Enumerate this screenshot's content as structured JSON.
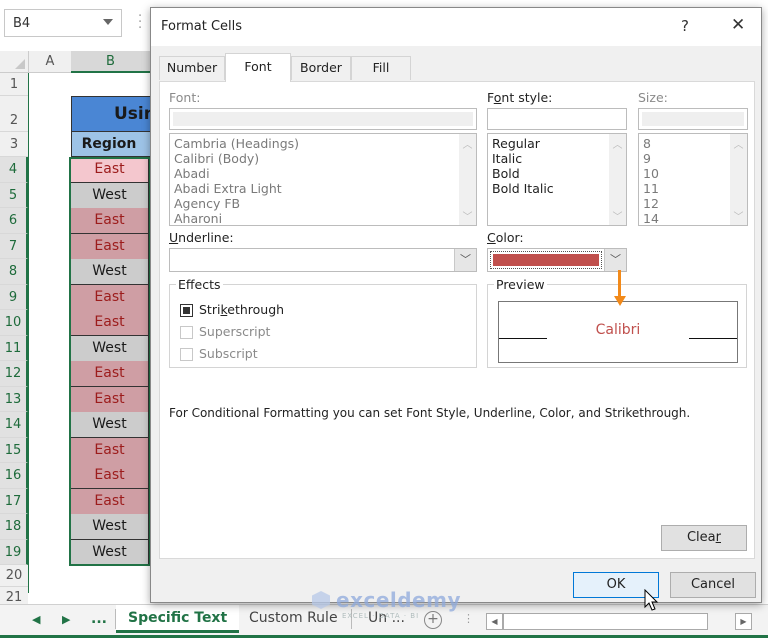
{
  "excel": {
    "name_box": "B4",
    "columns": [
      "A",
      "B"
    ],
    "rows": [
      "1",
      "2",
      "3",
      "4",
      "5",
      "6",
      "7",
      "8",
      "9",
      "10",
      "11",
      "12",
      "13",
      "14",
      "15",
      "16",
      "17",
      "18",
      "19",
      "20",
      "21"
    ],
    "title_cell": "Usin",
    "header_cell": "Region",
    "region_values": [
      "East",
      "West",
      "East",
      "East",
      "West",
      "East",
      "East",
      "West",
      "East",
      "East",
      "West",
      "East",
      "East",
      "East",
      "West",
      "West"
    ],
    "colors": {
      "accent": "#217346",
      "title_fill": "#4a86d4",
      "header_fill": "#9dc3e6",
      "east_fill": "#cf9ea4",
      "east_text": "#9c1c1c",
      "west_fill": "#cccccc"
    }
  },
  "sheet_tabs": {
    "nav_prev": "◀",
    "nav_next": "▶",
    "more": "...",
    "tabs": [
      {
        "label": "Specific Text",
        "active": true
      },
      {
        "label": "Custom Rule",
        "active": false
      },
      {
        "label": "Un ...",
        "active": false
      }
    ],
    "add_sheet": "+"
  },
  "watermark": {
    "brand": "exceldemy",
    "tagline": "EXCEL · DATA · BI"
  },
  "dialog": {
    "title": "Format Cells",
    "help": "?",
    "close": "✕",
    "tabs": [
      "Number",
      "Font",
      "Border",
      "Fill"
    ],
    "active_tab": "Font",
    "font": {
      "label": "Font:",
      "value": "",
      "options": [
        "Cambria (Headings)",
        "Calibri (Body)",
        "Abadi",
        "Abadi Extra Light",
        "Agency FB",
        "Aharoni"
      ]
    },
    "font_style": {
      "label_pre": "F",
      "label_u": "o",
      "label_post": "nt style:",
      "value": "",
      "options": [
        "Regular",
        "Italic",
        "Bold",
        "Bold Italic"
      ]
    },
    "size": {
      "label": "Size:",
      "value": "",
      "options": [
        "8",
        "9",
        "10",
        "11",
        "12",
        "14"
      ]
    },
    "underline": {
      "label_u": "U",
      "label_post": "nderline:",
      "value": ""
    },
    "color": {
      "label_u": "C",
      "label_post": "olor:",
      "value": "#c0504d"
    },
    "effects": {
      "label": "Effects",
      "strikethrough": {
        "label_pre": "Stri",
        "label_u": "k",
        "label_post": "ethrough",
        "state": "indeterminate"
      },
      "superscript": {
        "label": "Superscript",
        "enabled": false
      },
      "subscript": {
        "label": "Subscript",
        "enabled": false
      }
    },
    "preview": {
      "label": "Preview",
      "sample_text": "Calibri",
      "sample_color": "#c0504d"
    },
    "info_text": "For Conditional Formatting you can set Font Style, Underline, Color, and Strikethrough.",
    "clear_button": {
      "label_pre": "Clea",
      "label_u": "r"
    },
    "ok_button": "OK",
    "cancel_button": "Cancel"
  }
}
